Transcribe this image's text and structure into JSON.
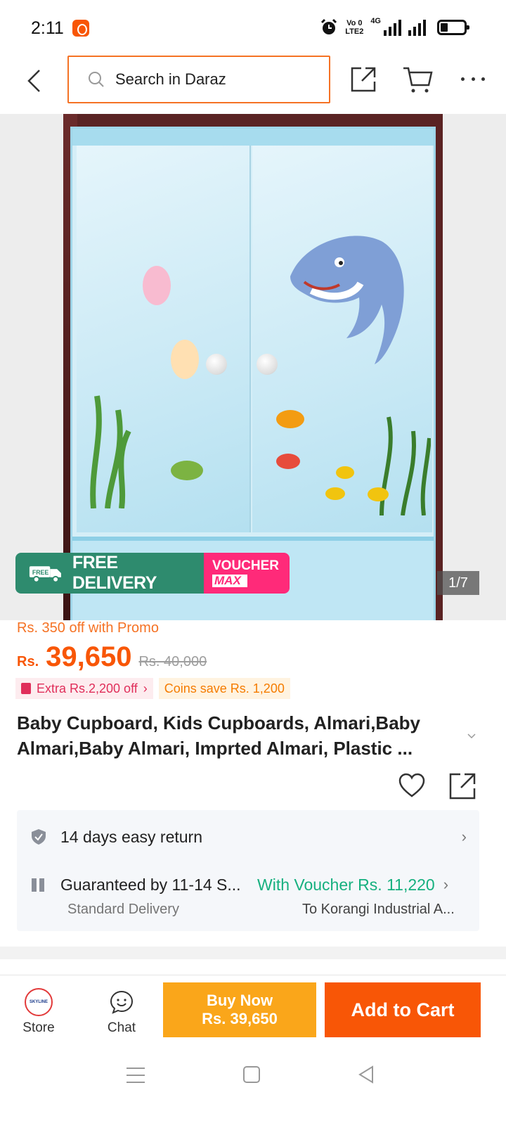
{
  "status": {
    "time": "2:11",
    "volte_line1": "Vo 0",
    "volte_line2": "LTE2",
    "network": "4G"
  },
  "header": {
    "search_placeholder": "Search in Daraz",
    "icons": [
      "back-icon",
      "search-icon",
      "share-icon",
      "cart-icon",
      "more-icon"
    ]
  },
  "gallery": {
    "badge_free_delivery": "FREE DELIVERY",
    "badge_free_small": "FREE",
    "badge_voucher": "VOUCHER",
    "badge_max": "MAX",
    "counter": "1/7"
  },
  "price": {
    "promo": "Rs. 350 off with Promo",
    "currency": "Rs.",
    "amount": "39,650",
    "original": "Rs. 40,000",
    "tag_extra": "Extra Rs.2,200 off",
    "tag_coins": "Coins save Rs. 1,200"
  },
  "product": {
    "title": "Baby Cupboard, Kids Cupboards, Almari,Baby Almari,Baby Almari, Imprted Almari, Plastic ..."
  },
  "service": {
    "return_text": "14 days easy return",
    "delivery_text": "Guaranteed by 11-14 S...",
    "voucher_text": "With Voucher Rs. 11,220",
    "delivery_type": "Standard Delivery",
    "destination": "To Korangi Industrial A..."
  },
  "bottom": {
    "store_label": "Store",
    "store_logo_text": "SKYLINE",
    "chat_label": "Chat",
    "buy_now_line1": "Buy Now",
    "buy_now_line2": "Rs. 39,650",
    "add_to_cart": "Add to Cart"
  },
  "colors": {
    "accent": "#f85606",
    "buy_now": "#faa61a",
    "free_delivery": "#2e8b6e",
    "voucher": "#ff2a79",
    "voucher_green": "#16b07f"
  }
}
